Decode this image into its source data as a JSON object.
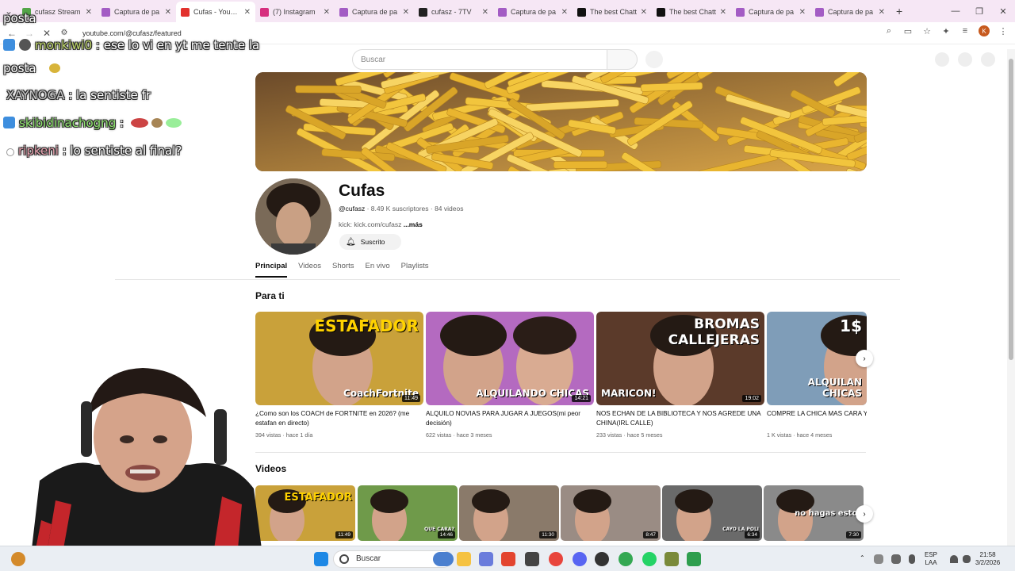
{
  "browser": {
    "tabs": [
      {
        "title": "cufasz Stream",
        "color": "#53a548"
      },
      {
        "title": "Captura de pa",
        "color": "#a35cc4"
      },
      {
        "title": "Cufas - YouTube",
        "color": "#e2312d",
        "active": true
      },
      {
        "title": "(7) Instagram",
        "color": "#d62f7e"
      },
      {
        "title": "Captura de pa",
        "color": "#a35cc4"
      },
      {
        "title": "cufasz - 7TV",
        "color": "#222222"
      },
      {
        "title": "Captura de pa",
        "color": "#a35cc4"
      },
      {
        "title": "The best Chatt",
        "color": "#111111"
      },
      {
        "title": "The best Chatt",
        "color": "#111111"
      },
      {
        "title": "Captura de pa",
        "color": "#a35cc4"
      },
      {
        "title": "Captura de pa",
        "color": "#a35cc4"
      }
    ],
    "url": "youtube.com/@cufasz/featured",
    "profile_initial": "K"
  },
  "youtube": {
    "search_placeholder": "Buscar",
    "channel": {
      "name": "Cufas",
      "handle": "@cufasz",
      "meta": " · 8.49 K suscriptores · 84 videos",
      "link": "kick: kick.com/cufasz ",
      "more": "...más",
      "subscribe_label": "Suscrito"
    },
    "tabs": [
      "Principal",
      "Videos",
      "Shorts",
      "En vivo",
      "Playlists"
    ],
    "section_for_you": "Para ti",
    "section_videos": "Videos",
    "for_you": [
      {
        "title": "¿Como son los COACH de FORTNITE en 2026? (me estafan en directo)",
        "stats": "394 vistas · hace 1 día",
        "duration": "11:49",
        "overlay": "ESTAFADOR",
        "overlay2": "CoachFortnite",
        "bg": "#c9a13a"
      },
      {
        "title": "ALQUILO NOVIAS PARA JUGAR A JUEGOS(mi peor decisión)",
        "stats": "622 vistas · hace 3 meses",
        "duration": "14:21",
        "overlay": "",
        "overlay2": "ALQUILANDO CHICAS",
        "bg": "#b46ac0"
      },
      {
        "title": "NOS ECHAN DE LA BIBLIOTECA Y NOS AGREDE UNA CHINA(IRL CALLE)",
        "stats": "233 vistas · hace 5 meses",
        "duration": "19:02",
        "overlay": "BROMAS CALLEJERAS",
        "overlay2": "MARICON!",
        "bg": "#5b3a2a"
      },
      {
        "title": "COMPRE LA CHICA MAS CARA Y PARA JUGAR FORTNITE(diferenc",
        "stats": "1 K vistas · hace 4 meses",
        "duration": "",
        "overlay": "1$",
        "overlay2": "ALQUILAN CHICAS",
        "bg": "#7f9db8"
      }
    ],
    "videos": [
      {
        "duration": "11:49",
        "bg": "#c9a13a",
        "label": "ESTAFADOR"
      },
      {
        "duration": "14:46",
        "bg": "#6f9a4a",
        "label": "QUE CARA?"
      },
      {
        "duration": "11:30",
        "bg": "#8a7a6a",
        "label": ""
      },
      {
        "duration": "8:47",
        "bg": "#9a8c84",
        "label": ""
      },
      {
        "duration": "6:34",
        "bg": "#6a6a6a",
        "label": "CAYO LA POLI"
      },
      {
        "duration": "7:30",
        "bg": "#8a8a8a",
        "label": "no hagas esto."
      }
    ]
  },
  "chat": [
    {
      "user": "posta",
      "msg": "",
      "color": "#ffffff"
    },
    {
      "user": "monkiwi0",
      "msg": " : ese lo vi en yt me tente la",
      "color": "#c0d86a"
    },
    {
      "user": "",
      "msg": "posta",
      "color": "#ffffff"
    },
    {
      "user": "XAYNOGA",
      "msg": " : la sentiste fr",
      "color": "#c9c9c9"
    },
    {
      "user": "skibidinachogng",
      "msg": " : ",
      "color": "#8fe36f"
    },
    {
      "user": "ripkeni",
      "msg": " : lo sentiste al final?",
      "color": "#e9a3b0"
    }
  ],
  "taskbar": {
    "search_label": "Buscar",
    "lang": "ESP",
    "lang2": "LAA",
    "time": "21:58",
    "date": "3/2/2026"
  }
}
